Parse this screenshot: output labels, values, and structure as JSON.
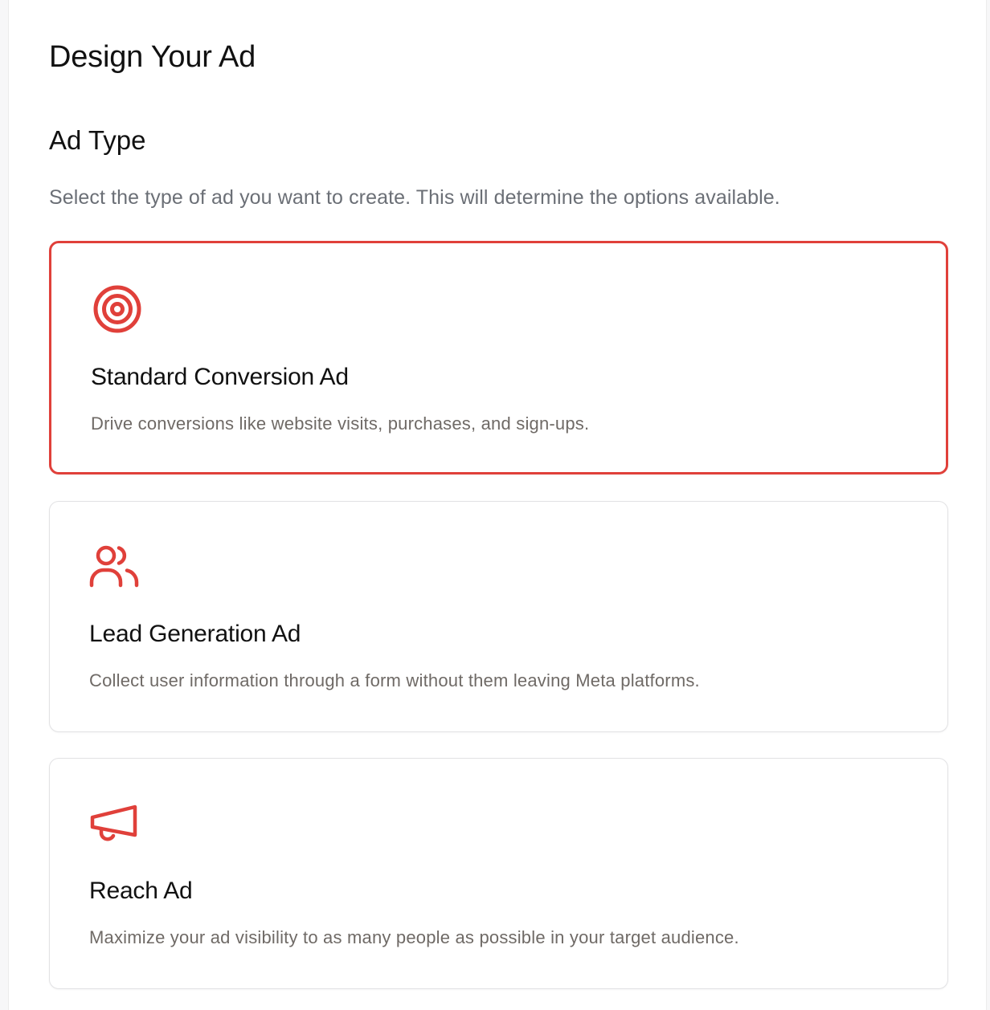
{
  "page": {
    "title": "Design Your Ad"
  },
  "section": {
    "title": "Ad Type",
    "description": "Select the type of ad you want to create. This will determine the options available."
  },
  "colors": {
    "accent": "#e0403a",
    "card_border": "#e2e2e4",
    "muted_text": "#6b6f76"
  },
  "ad_types": [
    {
      "icon": "target-icon",
      "title": "Standard Conversion Ad",
      "description": "Drive conversions like website visits, purchases, and sign-ups.",
      "selected": true
    },
    {
      "icon": "users-icon",
      "title": "Lead Generation Ad",
      "description": "Collect user information through a form without them leaving Meta platforms.",
      "selected": false
    },
    {
      "icon": "megaphone-icon",
      "title": "Reach Ad",
      "description": "Maximize your ad visibility to as many people as possible in your target audience.",
      "selected": false
    }
  ]
}
